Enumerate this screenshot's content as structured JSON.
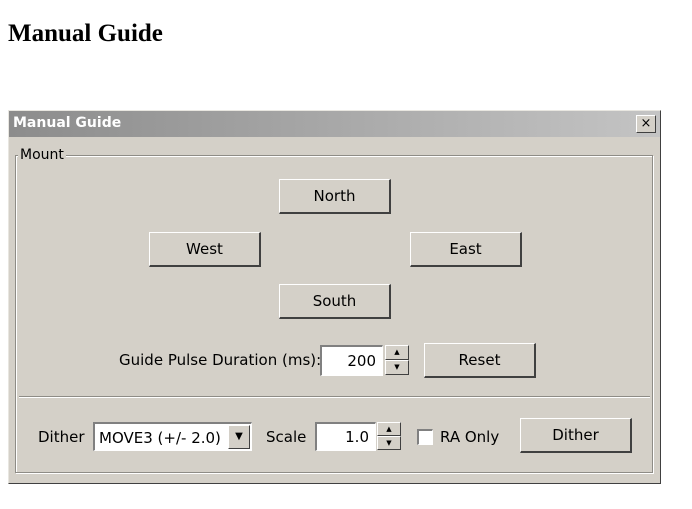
{
  "page": {
    "heading": "Manual Guide"
  },
  "dialog": {
    "title": "Manual Guide",
    "close_glyph": "×",
    "mount_label": "Mount",
    "north_label": "North",
    "west_label": "West",
    "east_label": "East",
    "south_label": "South",
    "pulse_label": "Guide Pulse Duration (ms):",
    "pulse_value": "200",
    "reset_label": "Reset",
    "dither_label": "Dither",
    "dither_mode": "MOVE3 (+/- 2.0)",
    "scale_label": "Scale",
    "scale_value": "1.0",
    "ra_only_label": "RA Only",
    "ra_only_checked": false,
    "dither_button_label": "Dither",
    "spin_up_glyph": "▲",
    "spin_down_glyph": "▼",
    "dropdown_glyph": "▼"
  }
}
